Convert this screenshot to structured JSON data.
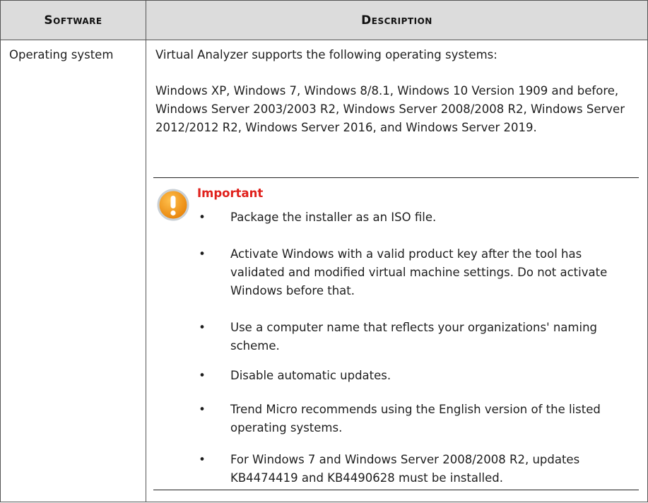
{
  "table": {
    "headers": {
      "software": "Software",
      "description": "Description"
    },
    "row": {
      "software": "Operating system",
      "intro": "Virtual Analyzer supports the following operating systems:",
      "os_list": "Windows XP, Windows 7, Windows 8/8.1, Windows 10 Version 1909 and before, Windows Server 2003/2003 R2, Windows Server 2008/2008 R2, Windows Server 2012/2012 R2, Windows Server 2016, and Windows Server 2019.",
      "important": {
        "icon": "exclamation-warning-icon",
        "icon_color": "#f39c12",
        "title_color": "#e0201b",
        "title": "Important",
        "bullet": "•",
        "items": [
          "Package the installer as an ISO file.",
          "Activate Windows with a valid product key after the tool has validated and modified virtual machine settings. Do not activate Windows before that.",
          "Use a computer name that reflects your organizations' naming scheme.",
          "Disable automatic updates.",
          "Trend Micro recommends using the English version of the listed operating systems.",
          "For Windows 7 and Windows Server 2008/2008 R2, updates KB4474419 and KB4490628 must be installed."
        ]
      }
    }
  }
}
